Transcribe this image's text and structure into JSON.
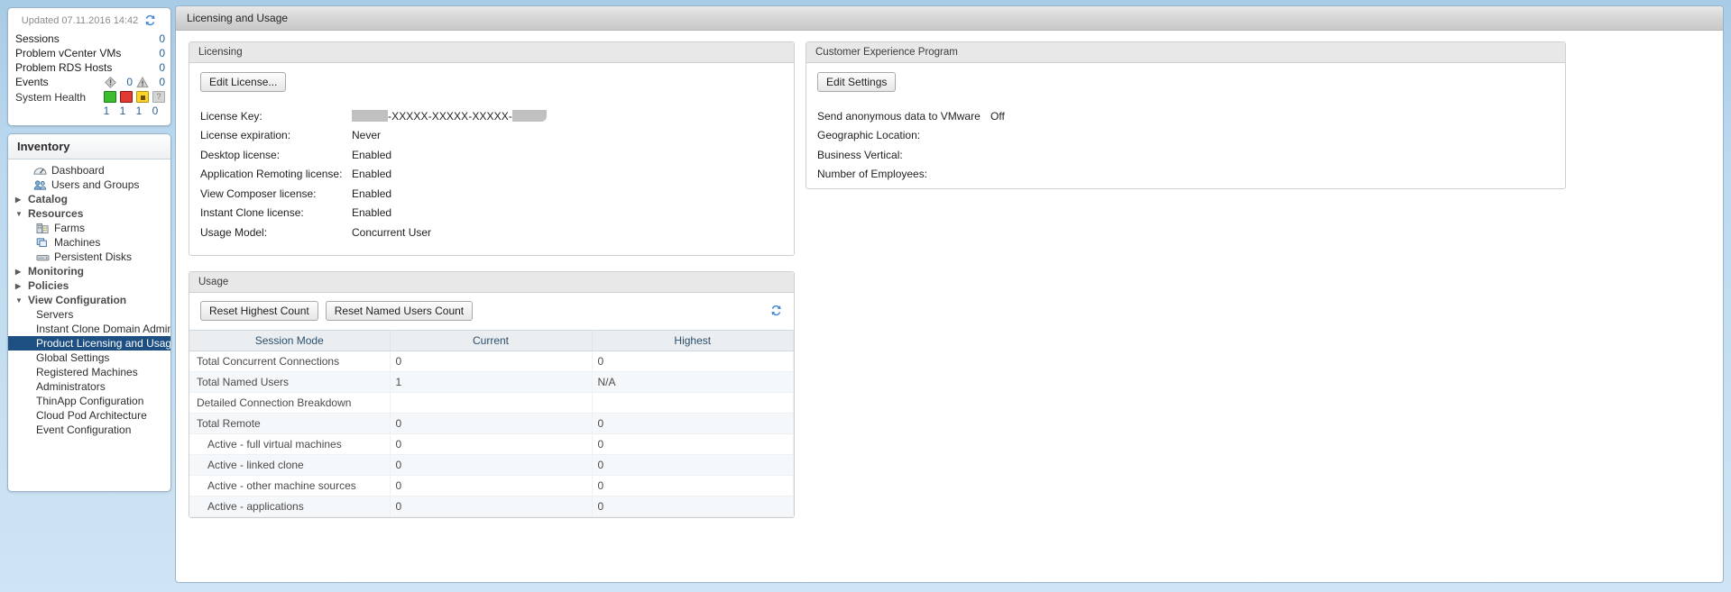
{
  "sidebar": {
    "updated_label": "Updated 07.11.2016 14:42",
    "refresh_icon": "refresh-icon",
    "summary": [
      {
        "label": "Sessions",
        "value": "0"
      },
      {
        "label": "Problem vCenter VMs",
        "value": "0"
      },
      {
        "label": "Problem RDS Hosts",
        "value": "0"
      }
    ],
    "events": {
      "label": "Events",
      "error_icon": "error-diamond-icon",
      "error_count": "0",
      "warning_icon": "warning-triangle-icon",
      "warning_count": "0"
    },
    "system_health": {
      "label": "System Health",
      "counts": [
        "1",
        "1",
        "1",
        "0"
      ]
    },
    "inventory_header": "Inventory",
    "tree": [
      {
        "label": "Dashboard",
        "type": "leaf",
        "icon": "dashboard-icon",
        "indent": 0
      },
      {
        "label": "Users and Groups",
        "type": "leaf",
        "icon": "users-groups-icon",
        "indent": 0
      },
      {
        "label": "Catalog",
        "type": "group",
        "state": "collapsed",
        "indent": 0
      },
      {
        "label": "Resources",
        "type": "group",
        "state": "expanded",
        "indent": 0
      },
      {
        "label": "Farms",
        "type": "leaf",
        "icon": "farms-icon",
        "indent": 1
      },
      {
        "label": "Machines",
        "type": "leaf",
        "icon": "machines-icon",
        "indent": 1
      },
      {
        "label": "Persistent Disks",
        "type": "leaf",
        "icon": "persistent-disks-icon",
        "indent": 1
      },
      {
        "label": "Monitoring",
        "type": "group",
        "state": "collapsed",
        "indent": 0
      },
      {
        "label": "Policies",
        "type": "group",
        "state": "collapsed",
        "indent": 0
      },
      {
        "label": "View Configuration",
        "type": "group",
        "state": "expanded",
        "indent": 0
      },
      {
        "label": "Servers",
        "type": "leaf",
        "indent": 1
      },
      {
        "label": "Instant Clone Domain Admins",
        "type": "leaf",
        "indent": 1
      },
      {
        "label": "Product Licensing and Usage",
        "type": "leaf",
        "indent": 1,
        "selected": true
      },
      {
        "label": "Global Settings",
        "type": "leaf",
        "indent": 1
      },
      {
        "label": "Registered Machines",
        "type": "leaf",
        "indent": 1
      },
      {
        "label": "Administrators",
        "type": "leaf",
        "indent": 1
      },
      {
        "label": "ThinApp Configuration",
        "type": "leaf",
        "indent": 1
      },
      {
        "label": "Cloud Pod Architecture",
        "type": "leaf",
        "indent": 1
      },
      {
        "label": "Event Configuration",
        "type": "leaf",
        "indent": 1
      }
    ]
  },
  "titlebar": {
    "title": "Licensing and Usage"
  },
  "licensing": {
    "panel_title": "Licensing",
    "edit_button": "Edit License...",
    "license_key_label": "License Key:",
    "license_key_value": "-XXXXX-XXXXX-XXXXX-",
    "rows": [
      {
        "label": "License expiration:",
        "value": "Never"
      },
      {
        "label": "Desktop license:",
        "value": "Enabled"
      },
      {
        "label": "Application Remoting license:",
        "value": "Enabled"
      },
      {
        "label": "View Composer license:",
        "value": "Enabled"
      },
      {
        "label": "Instant Clone license:",
        "value": "Enabled"
      },
      {
        "label": "Usage Model:",
        "value": "Concurrent User"
      }
    ]
  },
  "customer_experience": {
    "panel_title": "Customer Experience Program",
    "edit_button": "Edit Settings",
    "rows": [
      {
        "label": "Send anonymous data to VMware",
        "value": "Off"
      },
      {
        "label": "Geographic Location:",
        "value": ""
      },
      {
        "label": "Business Vertical:",
        "value": ""
      },
      {
        "label": "Number of Employees:",
        "value": ""
      }
    ]
  },
  "usage": {
    "panel_title": "Usage",
    "reset_highest_button": "Reset Highest Count",
    "reset_named_button": "Reset Named Users Count",
    "refresh_icon": "refresh-icon",
    "columns": [
      "Session Mode",
      "Current",
      "Highest"
    ],
    "rows": [
      {
        "mode": "Total Concurrent Connections",
        "current": "0",
        "highest": "0",
        "sub": false
      },
      {
        "mode": "Total Named Users",
        "current": "1",
        "highest": "N/A",
        "sub": false
      },
      {
        "mode": "Detailed Connection Breakdown",
        "current": "",
        "highest": "",
        "sub": false
      },
      {
        "mode": "Total Remote",
        "current": "0",
        "highest": "0",
        "sub": false
      },
      {
        "mode": "Active - full virtual machines",
        "current": "0",
        "highest": "0",
        "sub": true
      },
      {
        "mode": "Active - linked clone",
        "current": "0",
        "highest": "0",
        "sub": true
      },
      {
        "mode": "Active - other machine sources",
        "current": "0",
        "highest": "0",
        "sub": true
      },
      {
        "mode": "Active - applications",
        "current": "0",
        "highest": "0",
        "sub": true
      }
    ]
  },
  "colors": {
    "accent_blue": "#2a6099",
    "selection_blue": "#1d4f82",
    "health_green": "#3bbd2f",
    "health_red": "#e03a33",
    "health_yellow": "#ffd42a",
    "health_gray": "#d5d5d5"
  }
}
